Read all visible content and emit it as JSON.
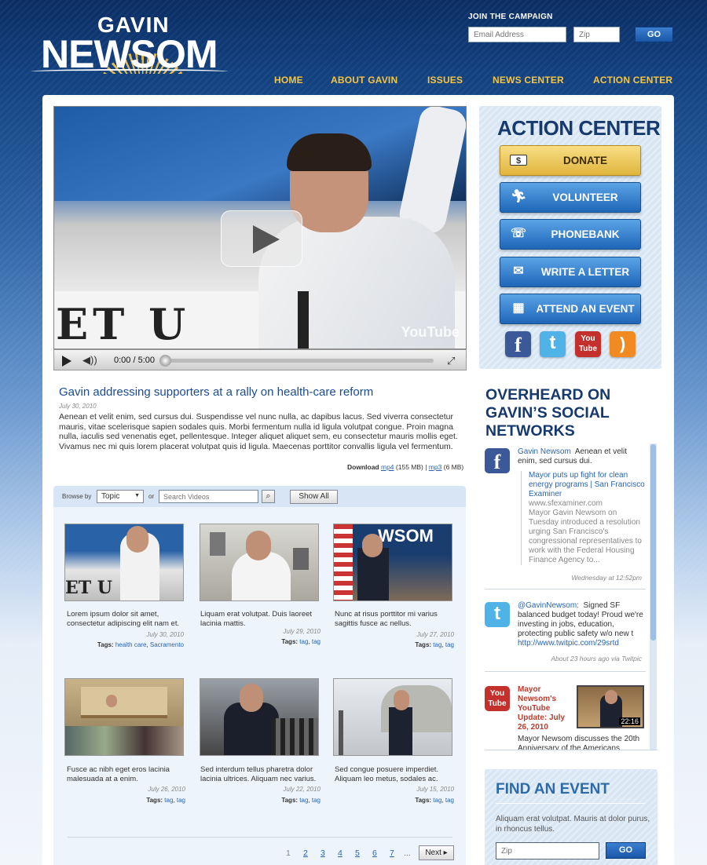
{
  "header": {
    "logo_top": "GAVIN",
    "logo_bottom": "NEWSOM",
    "join_label": "JOIN THE CAMPAIGN",
    "email_placeholder": "Email Address",
    "zip_placeholder": "Zip",
    "go_label": "GO",
    "nav": [
      "HOME",
      "ABOUT GAVIN",
      "ISSUES",
      "NEWS CENTER",
      "ACTION CENTER"
    ]
  },
  "video": {
    "banner_text": "ET U",
    "banner_text_right": "T",
    "watermark": "YouTube",
    "time": "0:00 / 5:00",
    "progress": 0,
    "title": "Gavin addressing supporters at a rally on health-care reform",
    "date": "July 30, 2010",
    "description": "Aenean et velit enim, sed cursus dui. Suspendisse vel nunc nulla, ac dapibus lacus. Sed viverra consectetur mauris, vitae scelerisque sapien sodales quis. Morbi fermentum nulla id ligula volutpat congue. Proin magna nulla, iaculis sed venenatis eget, pellentesque. Integer aliquet aliquet sem, eu consectetur mauris mollis eget. Vivamus nec mi quis lorem placerat volutpat quis id ligula. Maecenas porttitor convallis ligula vel fermentum.",
    "download_label": "Download",
    "mp4": "mp4",
    "mp4_size": "(155 MB)",
    "sep": "|",
    "mp3": "mp3",
    "mp3_size": "(6 MB)"
  },
  "browse": {
    "label": "Browse by",
    "select_value": "Topic",
    "or": "or",
    "search_placeholder": "Search Videos",
    "show_all": "Show All"
  },
  "videos": [
    {
      "caption": "Lorem ipsum dolor sit amet, consectetur adipiscing elit nam et.",
      "date": "July 30, 2010",
      "tags_label": "Tags:",
      "tag1": "health care",
      "tag2": "Sacramento"
    },
    {
      "caption": "Liquam erat volutpat. Duis laoreet lacinia mattis.",
      "date": "July 29, 2010",
      "tags_label": "Tags:",
      "tag1": "tag",
      "tag2": "tag"
    },
    {
      "caption": "Nunc at risus porttitor mi varius sagittis fusce ac nellus.",
      "date": "July 27, 2010",
      "tags_label": "Tags:",
      "tag1": "tag",
      "tag2": "tag"
    },
    {
      "caption": "Fusce ac nibh eget eros lacinia malesuada at a enim.",
      "date": "July 26, 2010",
      "tags_label": "Tags:",
      "tag1": "tag",
      "tag2": "tag"
    },
    {
      "caption": "Sed interdum tellus pharetra dolor lacinia ultrices. Aliquam nec varius.",
      "date": "July 22, 2010",
      "tags_label": "Tags:",
      "tag1": "tag",
      "tag2": "tag"
    },
    {
      "caption": "Sed congue posuere imperdiet. Aliquam leo metus, sodales ac.",
      "date": "July 15, 2010",
      "tags_label": "Tags:",
      "tag1": "tag",
      "tag2": "tag"
    }
  ],
  "pagination": {
    "current": "1",
    "pages": [
      "2",
      "3",
      "4",
      "5",
      "6",
      "7"
    ],
    "ellipsis": "...",
    "next": "Next"
  },
  "action_center": {
    "title": "ACTION CENTER",
    "buttons": [
      {
        "label": "DONATE",
        "icon": "money-icon"
      },
      {
        "label": "VOLUNTEER",
        "icon": "runner-icon"
      },
      {
        "label": "PHONEBANK",
        "icon": "phone-icon"
      },
      {
        "label": "WRITE A LETTER",
        "icon": "envelope-icon"
      },
      {
        "label": "ATTEND AN EVENT",
        "icon": "calendar-icon"
      }
    ],
    "social": [
      {
        "label": "f",
        "icon": "facebook-icon",
        "color": "#3b5998"
      },
      {
        "label": "t",
        "icon": "twitter-icon",
        "color": "#4fb3e8"
      },
      {
        "label": "You Tube",
        "icon": "youtube-icon",
        "color": "#c4302b"
      },
      {
        "label": ")",
        "icon": "rss-icon",
        "color": "#f18b21"
      }
    ]
  },
  "overheard": {
    "title": "OVERHEARD ON GAVIN’S SOCIAL NETWORKS",
    "fb": {
      "name": "Gavin Newsom",
      "text": "Aenean et velit enim, sed cursus dui.",
      "link": "Mayor puts up fight for clean energy programs | San Francisco Examiner",
      "domain": "www.sfexaminer.com",
      "summary": "Mayor Gavin Newsom on Tuesday introduced a resolution urging San Francisco's congressional representatives to work with the Federal Housing Finance Agency to...",
      "meta": "Wednesday at 12:52pm"
    },
    "tw": {
      "name": "@GavinNewsom:",
      "text": "Signed SF balanced budget today! Proud we're investing in jobs, education, protecting public safety w/o new t",
      "link": "http://www.twitpic.com/29srtd",
      "meta": "About 23 hours ago via Twitpic"
    },
    "yt": {
      "title": "Mayor Newsom's YouTube Update: July 26, 2010",
      "duration": "22:16",
      "text": "Mayor Newsom discusses the 20th Anniversary of the Americans"
    }
  },
  "find_event": {
    "title": "FIND AN EVENT",
    "desc": "Aliquam erat volutpat. Mauris at dolor purus, in rhoncus tellus.",
    "zip_placeholder": "Zip",
    "go_label": "GO"
  }
}
